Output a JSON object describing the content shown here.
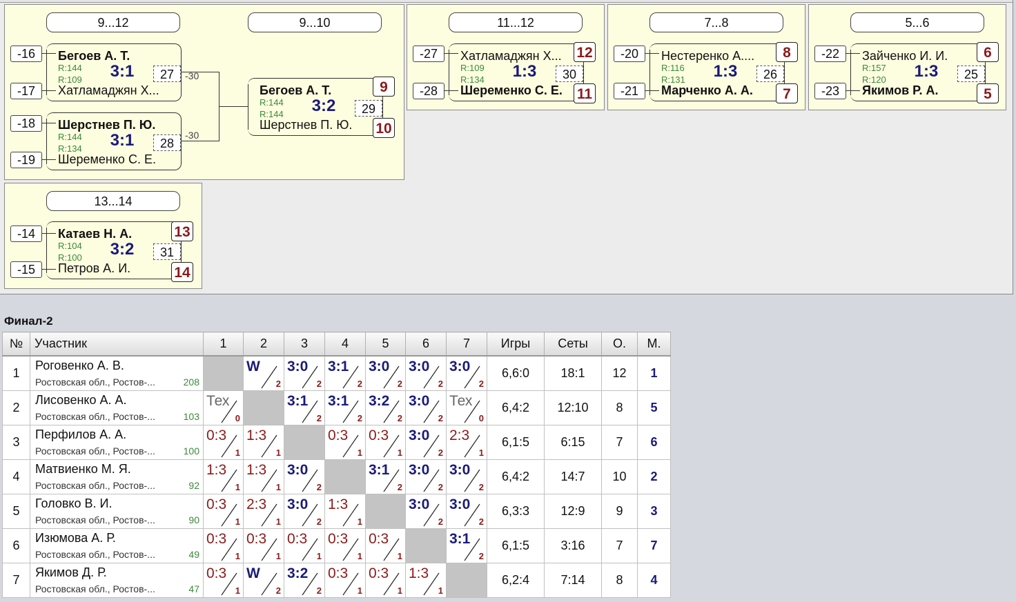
{
  "panels": {
    "p9_12": {
      "headers": [
        "9...12",
        "9...10"
      ],
      "m27": {
        "ref_top": "-16",
        "ref_bot": "-17",
        "p1": "Бегоев А. Т.",
        "p2": "Хатламаджян Х...",
        "r1": "R:144",
        "r2": "R:109",
        "score": "3:1",
        "num": "27",
        "loser": "-30"
      },
      "m28": {
        "ref_top": "-18",
        "ref_bot": "-19",
        "p1": "Шерстнев П. Ю.",
        "p2": "Шеременко С. Е.",
        "r1": "R:144",
        "r2": "R:134",
        "score": "3:1",
        "num": "28",
        "loser": "-30"
      },
      "m29": {
        "p1": "Бегоев А. Т.",
        "p2": "Шерстнев П. Ю.",
        "r1": "R:144",
        "r2": "R:144",
        "score": "3:2",
        "num": "29",
        "place1": "9",
        "place2": "10"
      }
    },
    "p11_12": {
      "header": "11...12",
      "ref_top": "-27",
      "ref_bot": "-28",
      "p1": "Хатламаджян Х...",
      "p2": "Шеременко С. Е.",
      "r1": "R:109",
      "r2": "R:134",
      "score": "1:3",
      "num": "30",
      "place1": "12",
      "place2": "11"
    },
    "p7_8": {
      "header": "7...8",
      "ref_top": "-20",
      "ref_bot": "-21",
      "p1": "Нестеренко А....",
      "p2": "Марченко А. А.",
      "r1": "R:116",
      "r2": "R:131",
      "score": "1:3",
      "num": "26",
      "place1": "8",
      "place2": "7"
    },
    "p5_6": {
      "header": "5...6",
      "ref_top": "-22",
      "ref_bot": "-23",
      "p1": "Зайченко И. И.",
      "p2": "Якимов Р. А.",
      "r1": "R:157",
      "r2": "R:120",
      "score": "1:3",
      "num": "25",
      "place1": "6",
      "place2": "5"
    },
    "p13_14": {
      "header": "13...14",
      "ref_top": "-14",
      "ref_bot": "-15",
      "p1": "Катаев Н. А.",
      "p2": "Петров А. И.",
      "r1": "R:104",
      "r2": "R:100",
      "score": "3:2",
      "num": "31",
      "place1": "13",
      "place2": "14"
    }
  },
  "final": {
    "title": "Финал-2",
    "headers": [
      "№",
      "Участник",
      "1",
      "2",
      "3",
      "4",
      "5",
      "6",
      "7",
      "Игры",
      "Сеты",
      "О.",
      "М."
    ],
    "rows": [
      {
        "no": "1",
        "name": "Роговенко А. В.",
        "region": "Ростовская обл., Ростов-...",
        "rating": "208",
        "cells": [
          null,
          {
            "t": "W",
            "k": "win",
            "p": "2"
          },
          {
            "t": "3:0",
            "k": "win",
            "p": "2"
          },
          {
            "t": "3:1",
            "k": "win",
            "p": "2"
          },
          {
            "t": "3:0",
            "k": "win",
            "p": "2"
          },
          {
            "t": "3:0",
            "k": "win",
            "p": "2"
          },
          {
            "t": "3:0",
            "k": "win",
            "p": "2"
          }
        ],
        "games": "6,6:0",
        "sets": "18:1",
        "points": "12",
        "place": "1"
      },
      {
        "no": "2",
        "name": "Лисовенко А. А.",
        "region": "Ростовская обл., Ростов-...",
        "rating": "103",
        "cells": [
          {
            "t": "Тех",
            "k": "tech",
            "p": "0"
          },
          null,
          {
            "t": "3:1",
            "k": "win",
            "p": "2"
          },
          {
            "t": "3:1",
            "k": "win",
            "p": "2"
          },
          {
            "t": "3:2",
            "k": "win",
            "p": "2"
          },
          {
            "t": "3:0",
            "k": "win",
            "p": "2"
          },
          {
            "t": "Тех",
            "k": "tech",
            "p": "0"
          }
        ],
        "games": "6,4:2",
        "sets": "12:10",
        "points": "8",
        "place": "5"
      },
      {
        "no": "3",
        "name": "Перфилов А. А.",
        "region": "Ростовская обл., Ростов-...",
        "rating": "100",
        "cells": [
          {
            "t": "0:3",
            "k": "loss",
            "p": "1"
          },
          {
            "t": "1:3",
            "k": "loss",
            "p": "1"
          },
          null,
          {
            "t": "0:3",
            "k": "loss",
            "p": "1"
          },
          {
            "t": "0:3",
            "k": "loss",
            "p": "1"
          },
          {
            "t": "3:0",
            "k": "win",
            "p": "2"
          },
          {
            "t": "2:3",
            "k": "loss",
            "p": "1"
          }
        ],
        "games": "6,1:5",
        "sets": "6:15",
        "points": "7",
        "place": "6"
      },
      {
        "no": "4",
        "name": "Матвиенко М. Я.",
        "region": "Ростовская обл., Ростов-...",
        "rating": "92",
        "cells": [
          {
            "t": "1:3",
            "k": "loss",
            "p": "1"
          },
          {
            "t": "1:3",
            "k": "loss",
            "p": "1"
          },
          {
            "t": "3:0",
            "k": "win",
            "p": "2"
          },
          null,
          {
            "t": "3:1",
            "k": "win",
            "p": "2"
          },
          {
            "t": "3:0",
            "k": "win",
            "p": "2"
          },
          {
            "t": "3:0",
            "k": "win",
            "p": "2"
          }
        ],
        "games": "6,4:2",
        "sets": "14:7",
        "points": "10",
        "place": "2"
      },
      {
        "no": "5",
        "name": "Головко В. И.",
        "region": "Ростовская обл., Ростов-...",
        "rating": "90",
        "cells": [
          {
            "t": "0:3",
            "k": "loss",
            "p": "1"
          },
          {
            "t": "2:3",
            "k": "loss",
            "p": "1"
          },
          {
            "t": "3:0",
            "k": "win",
            "p": "2"
          },
          {
            "t": "1:3",
            "k": "loss",
            "p": "1"
          },
          null,
          {
            "t": "3:0",
            "k": "win",
            "p": "2"
          },
          {
            "t": "3:0",
            "k": "win",
            "p": "2"
          }
        ],
        "games": "6,3:3",
        "sets": "12:9",
        "points": "9",
        "place": "3"
      },
      {
        "no": "6",
        "name": "Изюмова А. Р.",
        "region": "Ростовская обл., Ростов-...",
        "rating": "49",
        "cells": [
          {
            "t": "0:3",
            "k": "loss",
            "p": "1"
          },
          {
            "t": "0:3",
            "k": "loss",
            "p": "1"
          },
          {
            "t": "0:3",
            "k": "loss",
            "p": "1"
          },
          {
            "t": "0:3",
            "k": "loss",
            "p": "1"
          },
          {
            "t": "0:3",
            "k": "loss",
            "p": "1"
          },
          null,
          {
            "t": "3:1",
            "k": "win",
            "p": "2"
          }
        ],
        "games": "6,1:5",
        "sets": "3:16",
        "points": "7",
        "place": "7"
      },
      {
        "no": "7",
        "name": "Якимов Д. Р.",
        "region": "Ростовская обл., Ростов-...",
        "rating": "47",
        "cells": [
          {
            "t": "0:3",
            "k": "loss",
            "p": "1"
          },
          {
            "t": "W",
            "k": "win",
            "p": "2"
          },
          {
            "t": "3:2",
            "k": "win",
            "p": "2"
          },
          {
            "t": "0:3",
            "k": "loss",
            "p": "1"
          },
          {
            "t": "0:3",
            "k": "loss",
            "p": "1"
          },
          {
            "t": "1:3",
            "k": "loss",
            "p": "1"
          },
          null
        ],
        "games": "6,2:4",
        "sets": "7:14",
        "points": "8",
        "place": "4"
      }
    ]
  }
}
